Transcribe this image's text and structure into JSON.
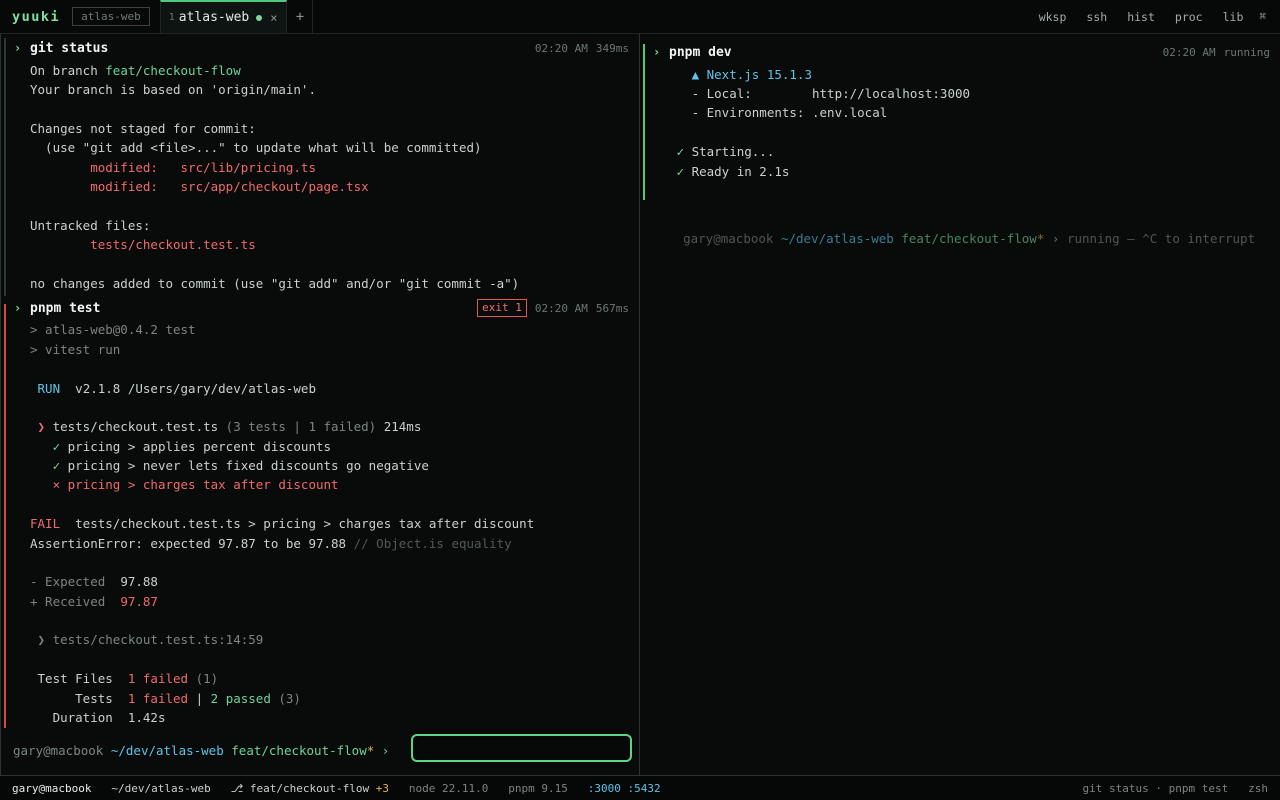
{
  "topbar": {
    "brand": "yuuki",
    "workspace": "atlas-web",
    "tab": {
      "index": "1",
      "name": "atlas-web",
      "close": "×"
    },
    "add": "+",
    "right_items": [
      "wksp",
      "ssh",
      "hist",
      "proc",
      "lib"
    ],
    "shortcut": "⌘"
  },
  "left_pane": {
    "git_block": {
      "chevron": "›",
      "command": "git status",
      "time": "02:20 AM",
      "duration": "349ms",
      "lines": {
        "l1a": "On branch ",
        "l1b": "feat/checkout-flow",
        "l2": "Your branch is based on 'origin/main'.",
        "l3": "Changes not staged for commit:",
        "l4": "  (use \"git add <file>...\" to update what will be committed)",
        "l5a": "        modified:   ",
        "l5b": "src/lib/pricing.ts",
        "l6a": "        modified:   ",
        "l6b": "src/app/checkout/page.tsx",
        "l7": "Untracked files:",
        "l8": "        tests/checkout.test.ts",
        "l9": "no changes added to commit (use \"git add\" and/or \"git commit -a\")"
      }
    },
    "test_block": {
      "chevron": "›",
      "command": "pnpm test",
      "exit": "exit 1",
      "time": "02:20 AM",
      "duration": "567ms",
      "lines": {
        "t1": "> atlas-web@0.4.2 test",
        "t2": "> vitest run",
        "t3a": " RUN ",
        "t3b": " v2.1.8 /Users/gary/dev/atlas-web",
        "t4a": " ❯ ",
        "t4b": "tests/checkout.test.ts",
        "t4c": " (3 tests | 1 failed)",
        "t4d": " 214ms",
        "t5a": "   ✓ ",
        "t5b": "pricing > applies percent discounts",
        "t6a": "   ✓ ",
        "t6b": "pricing > never lets fixed discounts go negative",
        "t7a": "   × ",
        "t7b": "pricing > charges tax after discount",
        "t8a": "FAIL",
        "t8b": "  tests/checkout.test.ts > pricing > charges tax after discount",
        "t9a": "AssertionError: expected 97.87 to be 97.88 ",
        "t9b": "// Object.is equality",
        "t10a": "- Expected",
        "t10b": "  97.88",
        "t11a": "+ Received",
        "t11b": "  97.87",
        "t12": " ❯ tests/checkout.test.ts:14:59",
        "t13a": " Test Files  ",
        "t13b": "1 failed",
        "t13c": " (1)",
        "t14a": "      Tests  ",
        "t14b": "1 failed",
        "t14c": " | ",
        "t14d": "2 passed",
        "t14e": " (3)",
        "t15a": "   Duration  ",
        "t15b": "1.42s"
      }
    },
    "prompt": {
      "user": "gary@macbook",
      "path": "~/dev/atlas-web",
      "branch": "feat/checkout-flow",
      "dirty": "*",
      "arrow": "›",
      "input_value": ""
    }
  },
  "right_pane": {
    "dev_block": {
      "chevron": "›",
      "command": "pnpm dev",
      "time": "02:20 AM",
      "status": "running",
      "lines": {
        "d1": "   ▲ Next.js 15.1.3",
        "d2a": "   - Local:        ",
        "d2b": "http://localhost:3000",
        "d3": "   - Environments: .env.local",
        "d4a": " ✓ ",
        "d4b": "Starting...",
        "d5a": " ✓ ",
        "d5b": "Ready in 2.1s"
      }
    },
    "prompt": {
      "user": "gary@macbook",
      "path": "~/dev/atlas-web",
      "branch": "feat/checkout-flow",
      "dirty": "*",
      "arrow": "›",
      "hint": "running — ^C to interrupt"
    }
  },
  "statusbar": {
    "user": "gary@macbook",
    "path": "~/dev/atlas-web",
    "branch_icon": "⎇",
    "branch": "feat/checkout-flow",
    "changes": "+3",
    "node": "node 22.11.0",
    "pnpm": "pnpm 9.15",
    "port1": ":3000",
    "port2": ":5432",
    "recent": "git status · pnpm test",
    "shell": "zsh"
  },
  "colors": {
    "accent": "#5fd389",
    "error": "#e25555",
    "cyan": "#5fc4e6",
    "dirty": "#e2b44a"
  }
}
